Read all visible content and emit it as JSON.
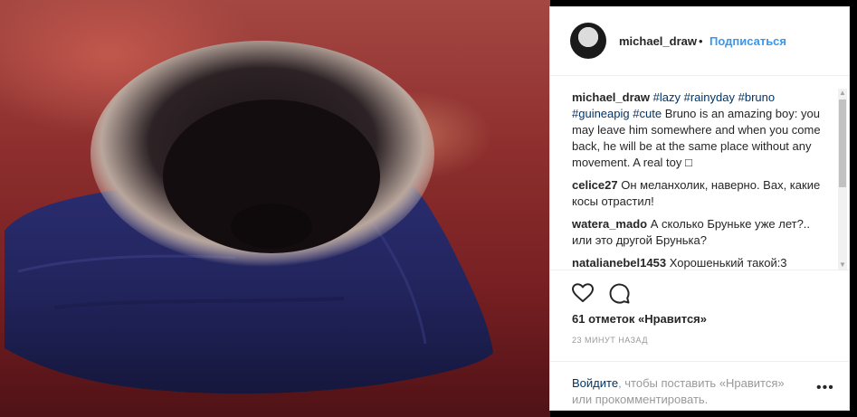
{
  "post": {
    "image_alt": "",
    "header": {
      "username": "michael_draw",
      "separator": "•",
      "follow_label": "Подписаться"
    },
    "caption": {
      "username": "michael_draw",
      "tags": [
        "#lazy",
        "#rainyday",
        "#bruno",
        "#guineapig",
        "#cute"
      ],
      "text": "Bruno is an amazing boy: you may leave him somewhere and when you come back, he will be at the same place without any movement. A real toy"
    },
    "comments": [
      {
        "username": "celice27",
        "text": "Он меланхолик, наверно. Вах, какие косы отрастил!"
      },
      {
        "username": "watera_mado",
        "text": "А сколько Бруньке уже лет?.. или это другой Брунька?"
      },
      {
        "username": "natalianebel1453",
        "text": "Хорошенький такой:3"
      }
    ],
    "likes": "61 отметок «Нравится»",
    "timestamp": "23 МИНУТ НАЗАД",
    "login": {
      "link": "Войдите",
      "text": ", чтобы поставить «Нравится» или прокомментировать."
    },
    "more_label": "•••",
    "icons": {
      "like": "heart-icon",
      "comment": "comment-icon",
      "more": "more-options-icon"
    }
  },
  "colors": {
    "follow": "#3897f0",
    "link": "#003569",
    "muted": "#999999"
  }
}
